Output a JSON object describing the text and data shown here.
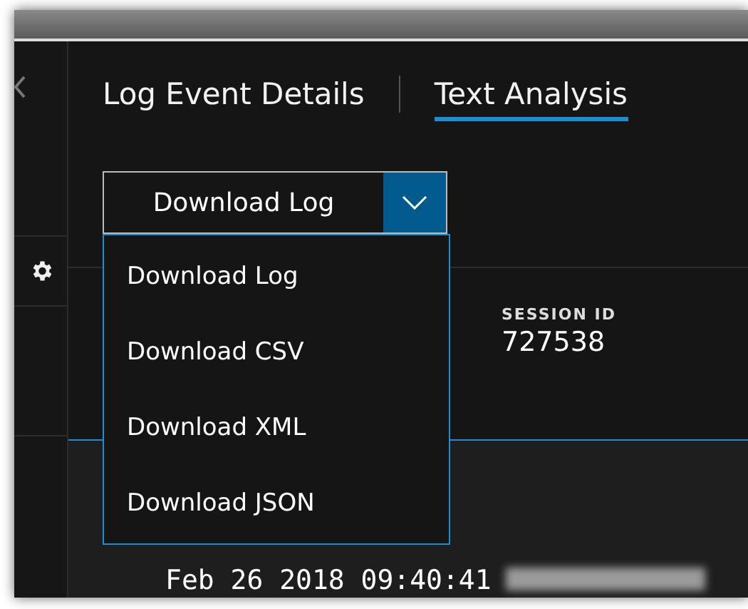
{
  "tabs": [
    {
      "label": "Log Event Details",
      "selected": false
    },
    {
      "label": "Text Analysis",
      "selected": true
    }
  ],
  "download_dropdown": {
    "value": "Download Log",
    "expanded": true,
    "options": [
      {
        "label": "Download Log"
      },
      {
        "label": "Download CSV"
      },
      {
        "label": "Download XML"
      },
      {
        "label": "Download JSON"
      }
    ]
  },
  "details": [
    {
      "label": "SESSION ID",
      "value": "727538"
    }
  ],
  "log_line": {
    "timestamp": "Feb 26 2018 09:40:41"
  }
}
